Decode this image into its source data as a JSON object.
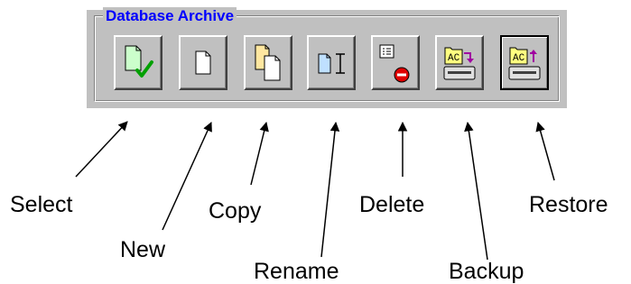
{
  "group": {
    "title": "Database Archive"
  },
  "buttons": [
    {
      "id": "select",
      "label": "Select",
      "icon": "document-check-icon"
    },
    {
      "id": "new",
      "label": "New",
      "icon": "new-document-icon"
    },
    {
      "id": "copy",
      "label": "Copy",
      "icon": "copy-documents-icon"
    },
    {
      "id": "rename",
      "label": "Rename",
      "icon": "rename-document-icon"
    },
    {
      "id": "delete",
      "label": "Delete",
      "icon": "delete-document-icon"
    },
    {
      "id": "backup",
      "label": "Backup",
      "icon": "backup-drive-icon"
    },
    {
      "id": "restore",
      "label": "Restore",
      "icon": "restore-drive-icon"
    }
  ],
  "drive_icon_text": "AC",
  "colors": {
    "title": "#0000ff",
    "panel": "#c0c0c0",
    "check": "#00a000",
    "delete": "#e00000",
    "backup_arrow": "#a000a0"
  }
}
